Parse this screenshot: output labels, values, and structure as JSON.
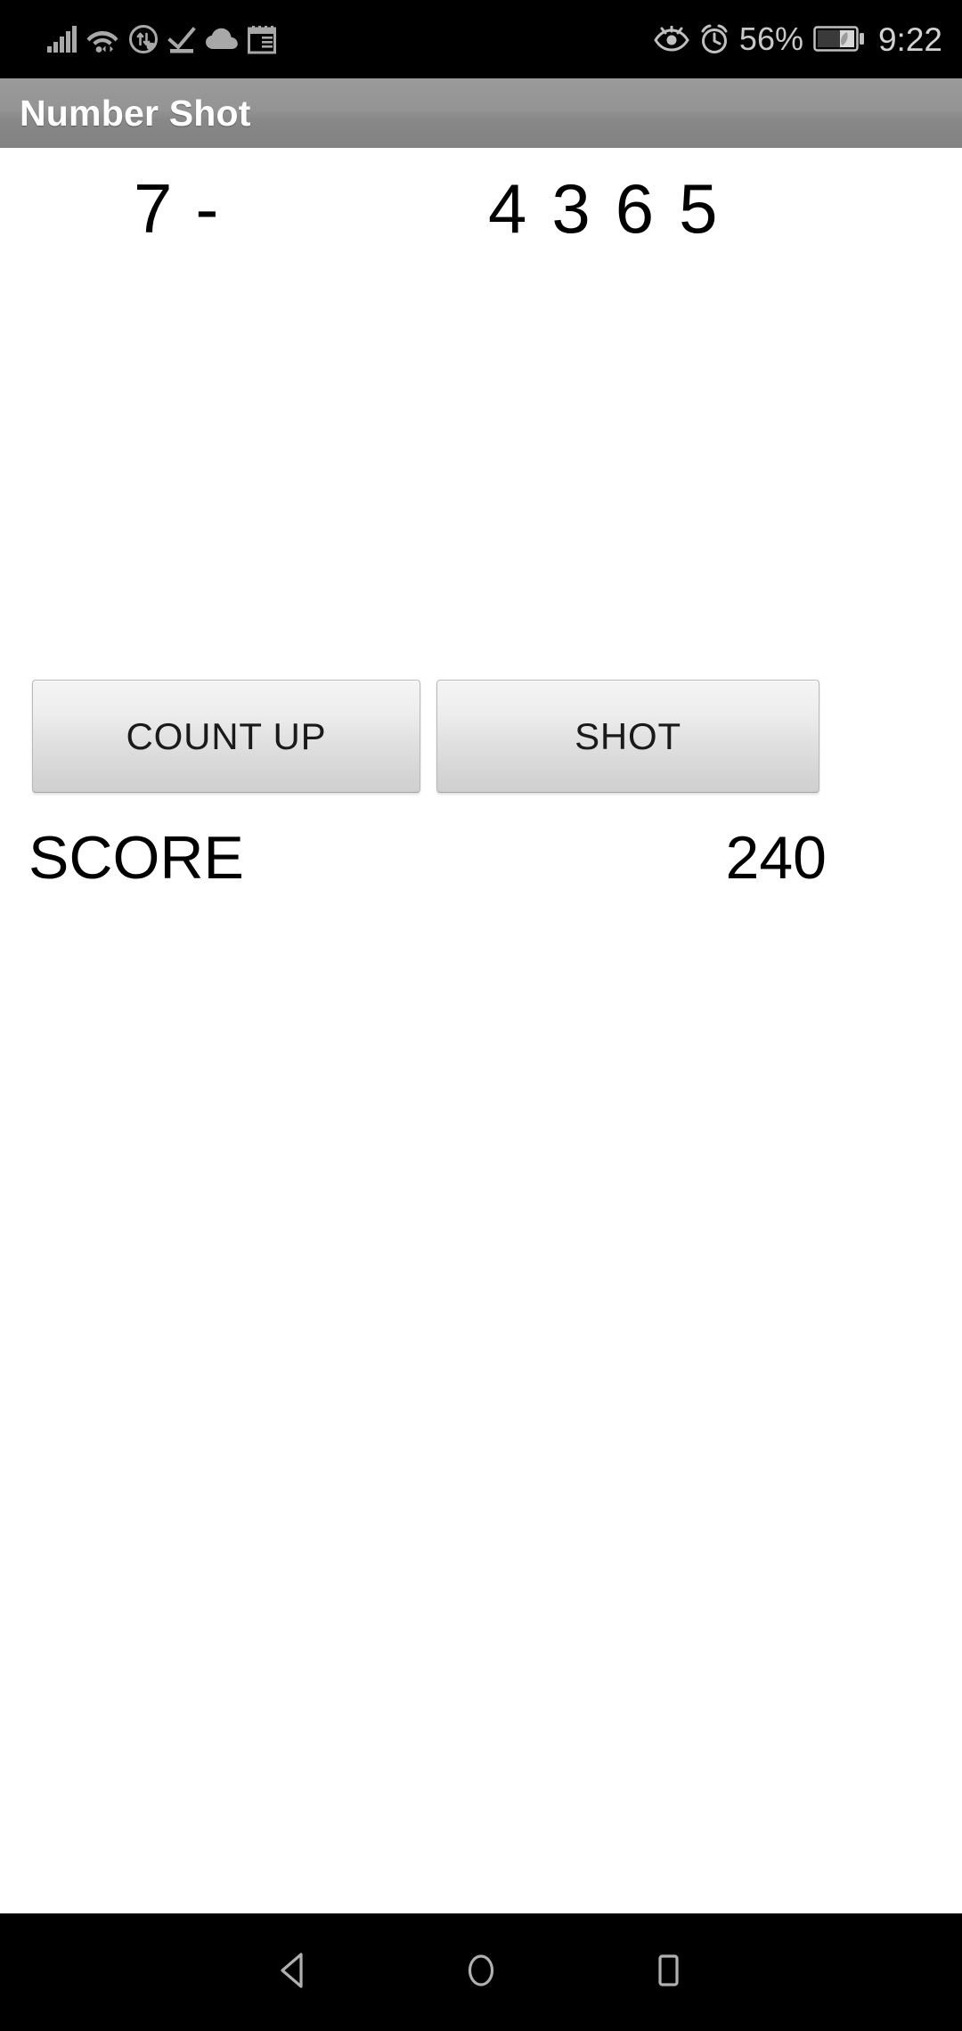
{
  "status_bar": {
    "left_icons": [
      {
        "name": "signal-bars-icon",
        "label": "cellular signal"
      },
      {
        "name": "wifi-icon",
        "label": "wi-fi with data arrows"
      },
      {
        "name": "data-saver-icon",
        "label": "power saving data"
      },
      {
        "name": "download-complete-icon",
        "label": "download complete"
      },
      {
        "name": "cloud-icon",
        "label": "cloud sync"
      },
      {
        "name": "calendar-icon",
        "label": "calendar event"
      }
    ],
    "right_icons": [
      {
        "name": "eye-comfort-icon",
        "label": "eye comfort mode"
      },
      {
        "name": "alarm-icon",
        "label": "alarm set"
      }
    ],
    "battery_percent": "56%",
    "battery_icon": "battery-saver-icon",
    "clock": "9:22"
  },
  "action_bar": {
    "title": "Number Shot"
  },
  "game": {
    "target_number": "7",
    "separator": "-",
    "guess_digits": [
      "4",
      "3",
      "6",
      "5"
    ],
    "guess_string": "4365",
    "score_label": "SCORE",
    "score_value": "240"
  },
  "buttons": {
    "count_up": "COUNT UP",
    "shot": "SHOT"
  },
  "nav_bar": {
    "back": "back-icon",
    "home": "home-icon",
    "recents": "recents-icon"
  },
  "colors": {
    "status_bar_bg": "#000000",
    "action_bar_top": "#9a9a9a",
    "action_bar_bottom": "#828282",
    "content_bg": "#ffffff",
    "text": "#000000",
    "title_text": "#ffffff",
    "nav_bg": "#000000",
    "nav_icon": "#b0b0b0"
  }
}
